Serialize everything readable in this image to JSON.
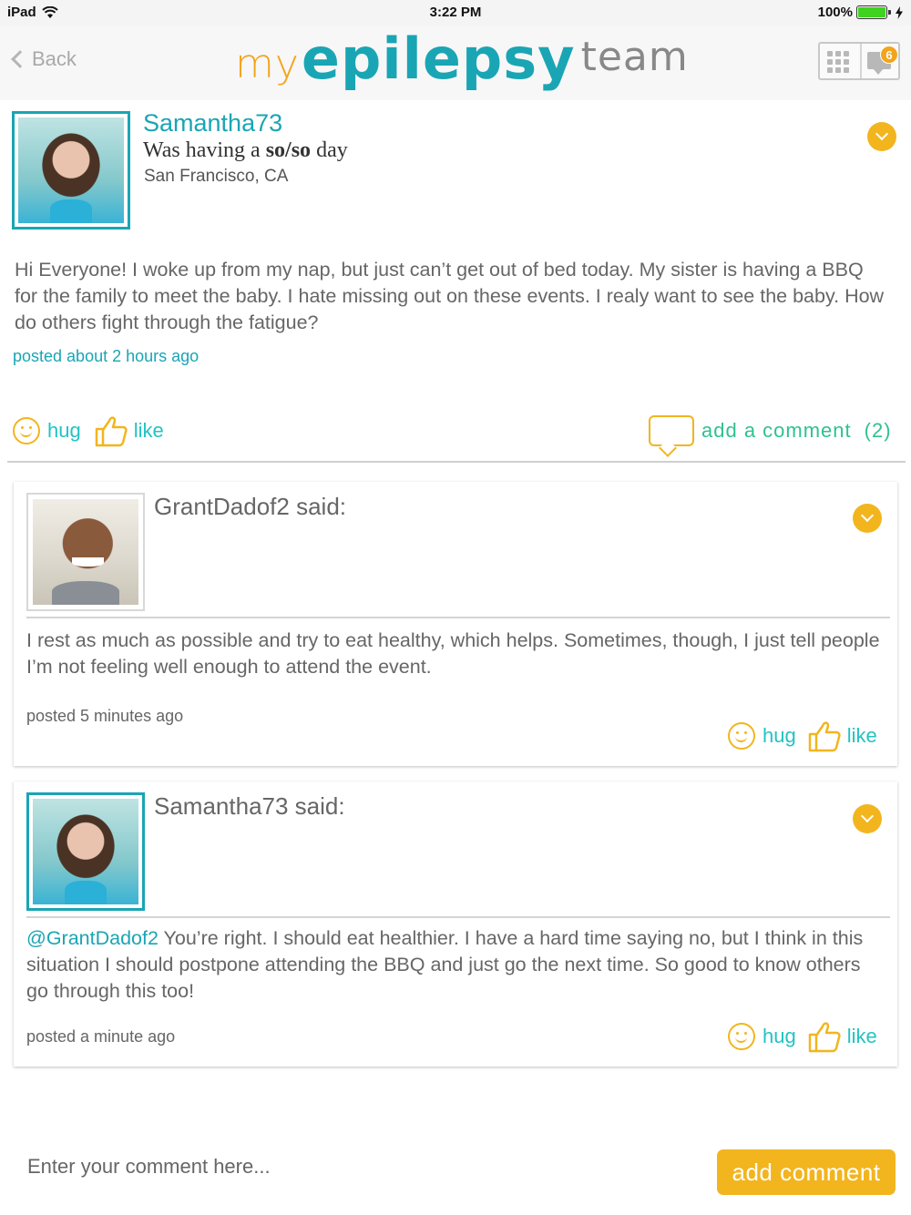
{
  "status_bar": {
    "device": "iPad",
    "time": "3:22 PM",
    "battery": "100%"
  },
  "nav": {
    "back_label": "Back",
    "logo": {
      "my": "my",
      "epilepsy": "epilepsy",
      "team": "team"
    },
    "notification_count": "6"
  },
  "post": {
    "username": "Samantha73",
    "mood_prefix": "Was having a ",
    "mood": "so/so",
    "mood_suffix": " day",
    "location": "San Francisco, CA",
    "body": "Hi Everyone! I woke up from my nap, but just can’t get out of bed today. My sister is having a BBQ for the family to meet the baby.  I hate missing out on these events.  I realy want to see the baby.  How do others fight through the fatigue?",
    "time": "posted about 2 hours ago",
    "hug_label": "hug",
    "like_label": "like",
    "add_comment_label": "add a comment",
    "comment_count": "(2)"
  },
  "comments": [
    {
      "title": "GrantDadof2 said:",
      "mention": "",
      "body": "I rest as much as possible and try to eat healthy, which helps.  Sometimes, though, I just tell people I’m not feeling well enough to attend the event.",
      "time": "posted 5 minutes ago",
      "hug_label": "hug",
      "like_label": "like"
    },
    {
      "title": "Samantha73 said:",
      "mention": "@GrantDadof2",
      "body": " You’re right. I should eat healthier. I have a hard time saying no, but I think in this situation I should postpone attending the BBQ and just go the next time. So good to know others go through this too!",
      "time": "posted a  minute ago",
      "hug_label": "hug",
      "like_label": "like"
    }
  ],
  "composer": {
    "placeholder": "Enter your comment here...",
    "button_label": "add comment"
  },
  "colors": {
    "teal": "#1aa5b4",
    "gold": "#f2b51e",
    "green": "#2ec28e",
    "battery": "#3fd21f"
  }
}
